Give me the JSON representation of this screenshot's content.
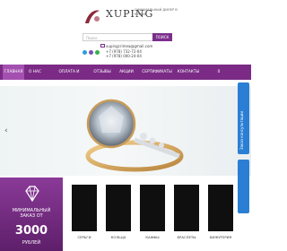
{
  "brand": {
    "name": "XUPING",
    "tagline": "ОФИЦИАЛЬНЫЙ ДИЛЕР В КРЫМУ"
  },
  "search": {
    "placeholder": "Поиск",
    "button": "ПОИСК"
  },
  "contact": {
    "email": "xupingcrimea@gmail.com",
    "phone1": "+7 (978) 732-72-04",
    "phone2": "+7 (978) 000-24-04"
  },
  "nav": [
    "ГЛАВНАЯ",
    "О НАС",
    "ОПЛАТА И ДОСТАВКА",
    "ОТЗЫВЫ",
    "АКЦИИ",
    "СЕРТИФИКАТЫ",
    "КОНТАКТЫ"
  ],
  "cart": {
    "count": "0"
  },
  "side_tab": "Заказ консультации",
  "promo": {
    "line": "МИНИМАЛЬНЫЙ ЗАКАЗ ОТ",
    "sum": "3000",
    "unit": "РУБЛЕЙ"
  },
  "categories": [
    "СЕРЬГИ",
    "КОЛЬЦА",
    "КАФФЫ",
    "БРАСЛЕТЫ",
    "БИЖУТЕРИЯ"
  ],
  "colors": {
    "accent": "#7b2b86",
    "side": "#2a7fd4"
  }
}
